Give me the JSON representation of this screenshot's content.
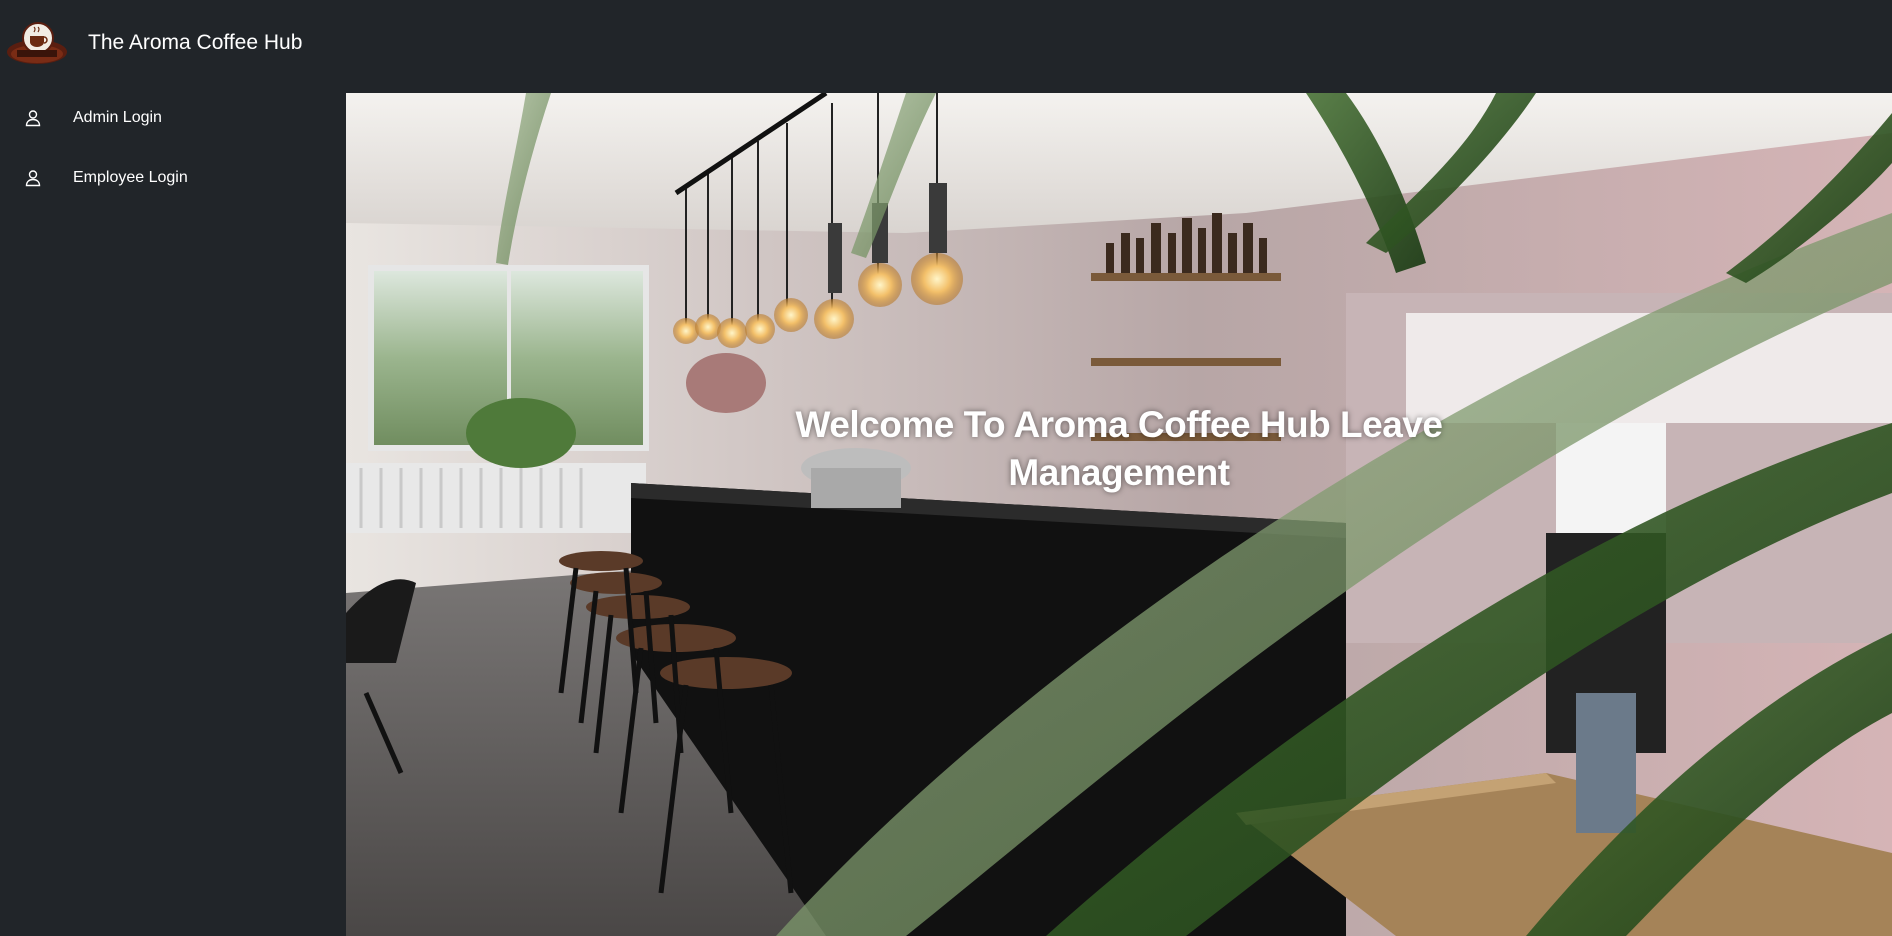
{
  "header": {
    "brand": "The Aroma Coffee Hub",
    "logo_icon": "coffee-cup-logo-icon"
  },
  "sidebar": {
    "items": [
      {
        "label": "Admin Login",
        "icon": "user-icon"
      },
      {
        "label": "Employee Login",
        "icon": "user-icon"
      }
    ]
  },
  "hero": {
    "title_line1": "Welcome To Aroma Coffee Hub Leave",
    "title_line2": "Management"
  },
  "colors": {
    "background": "#212529",
    "text": "#ffffff"
  }
}
